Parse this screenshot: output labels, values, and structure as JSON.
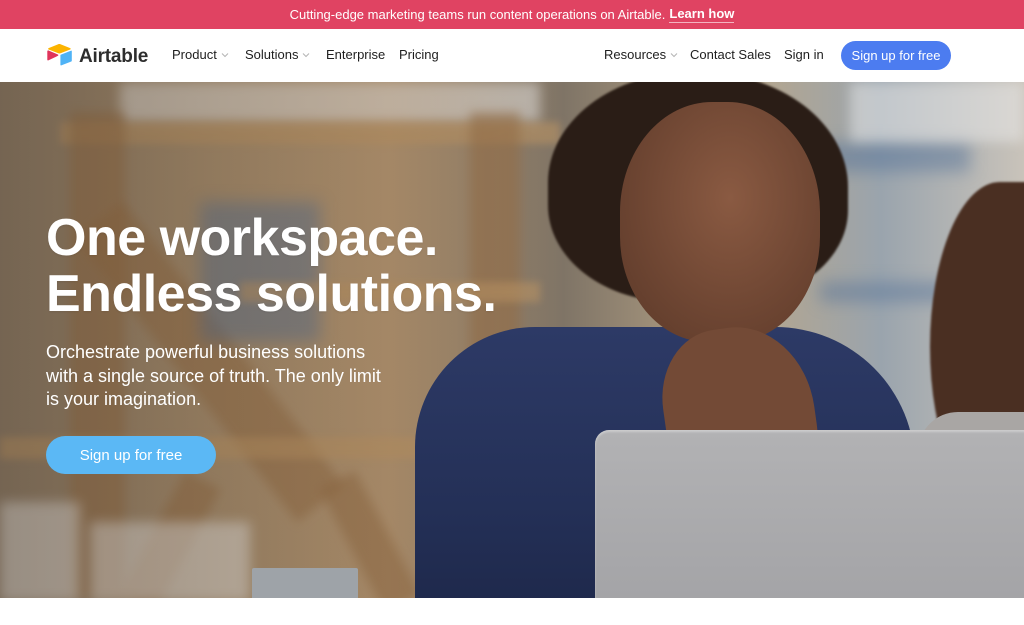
{
  "banner": {
    "text": "Cutting-edge marketing teams run content operations on Airtable.",
    "link_label": "Learn how"
  },
  "nav": {
    "logo": {
      "icon": "airtable-logo-icon",
      "text": "Airtable"
    },
    "left_items": [
      {
        "label": "Product",
        "has_dropdown": true
      },
      {
        "label": "Solutions",
        "has_dropdown": true
      },
      {
        "label": "Enterprise",
        "has_dropdown": false
      },
      {
        "label": "Pricing",
        "has_dropdown": false
      }
    ],
    "right_items": [
      {
        "label": "Resources",
        "has_dropdown": true
      },
      {
        "label": "Contact Sales",
        "has_dropdown": false
      },
      {
        "label": "Sign in",
        "has_dropdown": false
      }
    ],
    "cta_label": "Sign up for free"
  },
  "hero": {
    "title_lines": [
      "One workspace.",
      "Endless solutions."
    ],
    "subtitle": "Orchestrate powerful business solutions with a single source of truth. The only limit is your imagination.",
    "cta_label": "Sign up for free",
    "image_description": "Woman in navy polo shirt with hand on chin looking at a laptop in a warehouse, second person partially visible at right"
  },
  "colors": {
    "banner_bg": "#e04362",
    "nav_cta_bg": "#4c7cf0",
    "hero_cta_bg": "#5bb8f5",
    "logo_yellow": "#fcb400",
    "logo_red": "#e0345b",
    "logo_blue": "#4fb3f6"
  }
}
